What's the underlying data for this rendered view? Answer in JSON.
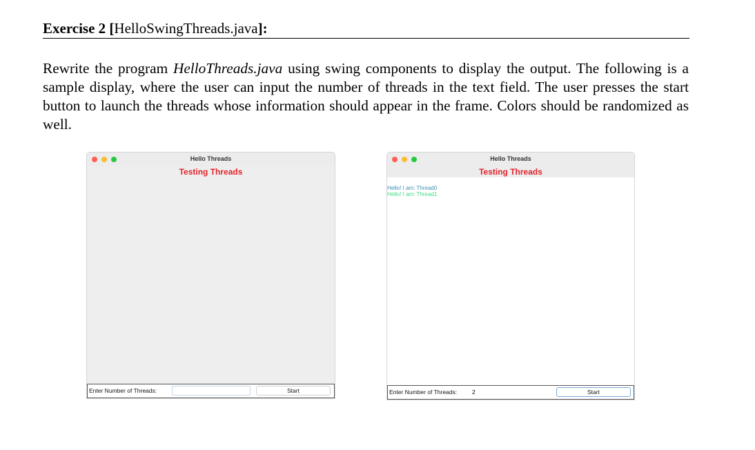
{
  "heading": {
    "exercise": "Exercise 2 ",
    "open": "[",
    "file": "HelloSwingThreads.java",
    "close": "]:"
  },
  "paragraph": {
    "part1": "Rewrite the program ",
    "program": "HelloThreads.java",
    "part2": " using swing components to display the output. The following is a sample display, where the user can input the number of threads in the text field. The user presses the start button to launch the threads whose information should appear in the frame. Colors should be randomized as well."
  },
  "windows": [
    {
      "title": "Hello Threads",
      "banner": "Testing Threads",
      "lines": [],
      "input_label": "Enter Number of Threads:",
      "input_value": "",
      "button_label": "Start"
    },
    {
      "title": "Hello Threads",
      "banner": "Testing Threads",
      "lines": [
        {
          "text": "Hello! I am: Thread0",
          "color": "#3a8fb7"
        },
        {
          "text": "Hello! I am: Thread1",
          "color": "#3ddc84"
        }
      ],
      "input_label": "Enter Number of Threads:",
      "input_value": "2",
      "button_label": "Start"
    }
  ],
  "colors": {
    "banner": "#e3242b",
    "close_dot": "#fe5f57",
    "minimize_dot": "#febc2e",
    "zoom_dot": "#28c840"
  }
}
